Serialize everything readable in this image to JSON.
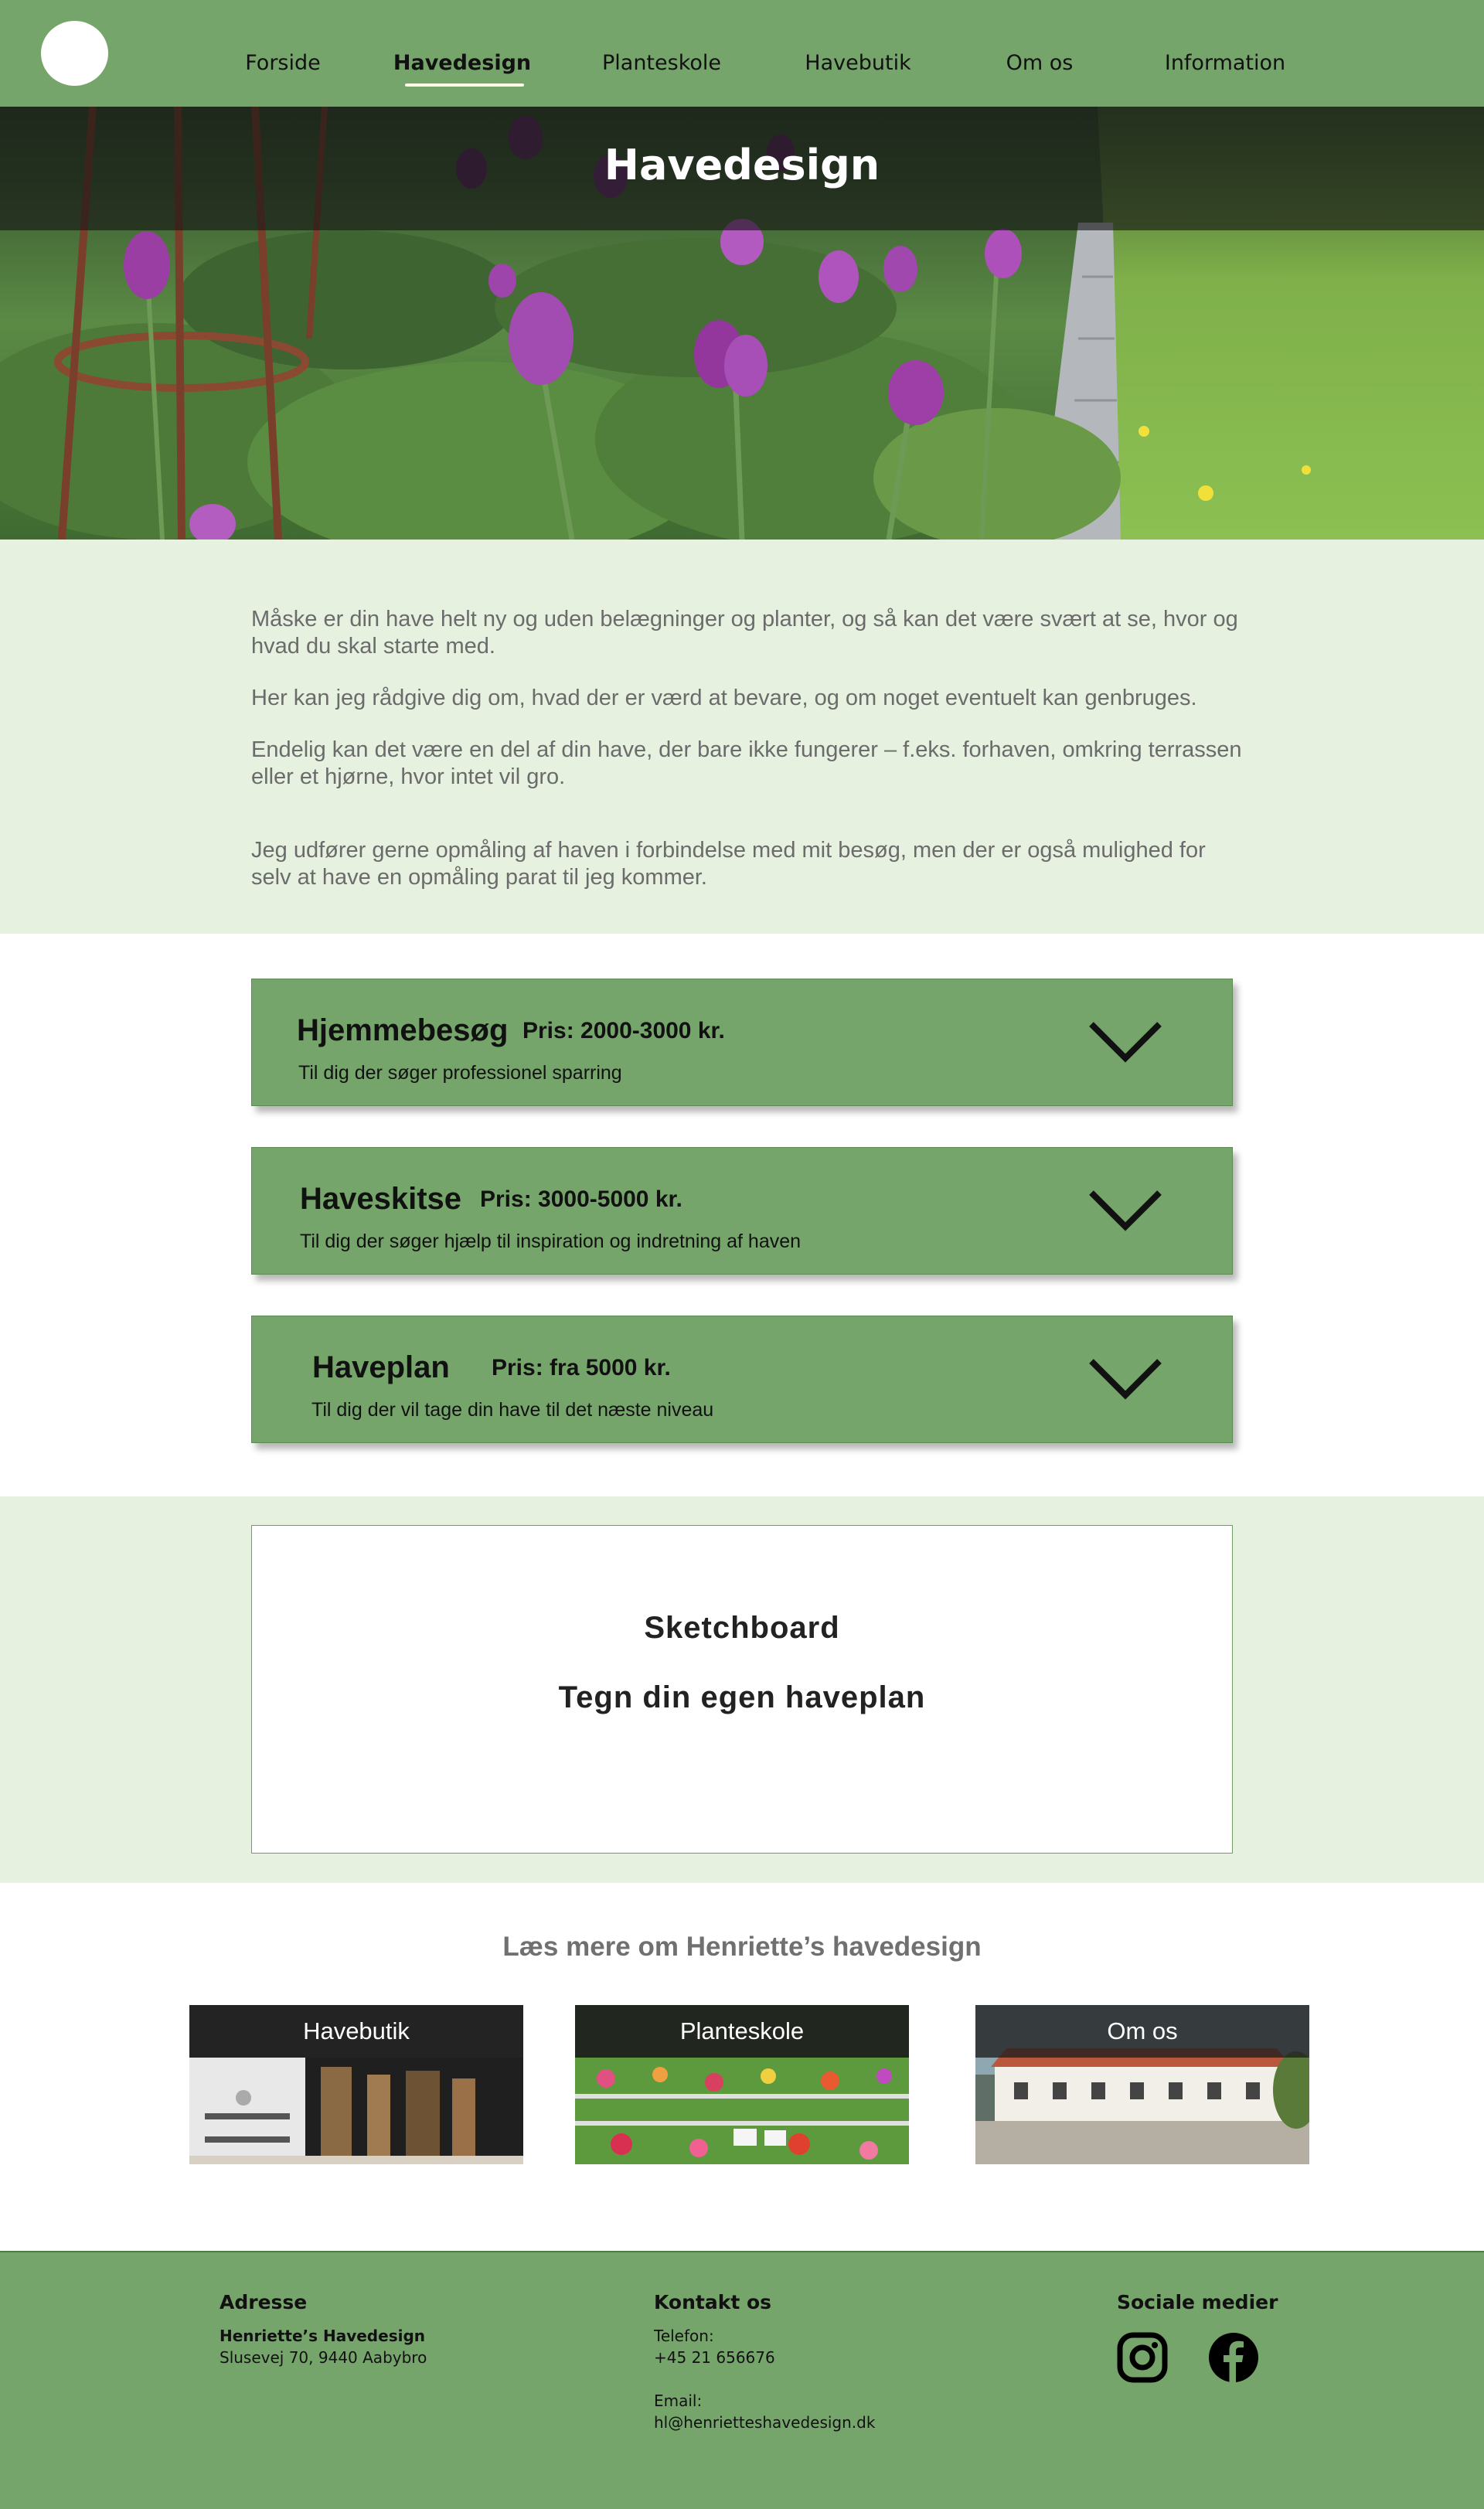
{
  "nav": {
    "items": [
      {
        "label": "Forside"
      },
      {
        "label": "Havedesign"
      },
      {
        "label": "Planteskole"
      },
      {
        "label": "Havebutik"
      },
      {
        "label": "Om os"
      },
      {
        "label": "Information"
      }
    ],
    "active": "Havedesign"
  },
  "hero": {
    "title": "Havedesign"
  },
  "intro": {
    "paragraphs": [
      "Måske er din have helt ny og uden belægninger og planter, og så kan det være svært at se, hvor og hvad du skal starte med.",
      "Her kan jeg rådgive dig om, hvad der er værd at bevare, og om noget eventuelt kan genbruges.",
      "Endelig kan det være en del af din have, der bare ikke fungerer – f.eks. forhaven, omkring terrassen eller et hjørne, hvor intet vil gro.",
      "Jeg udfører gerne opmåling af haven i forbindelse med mit besøg, men der er også mulighed for selv at have en opmåling parat til jeg kommer."
    ]
  },
  "services": [
    {
      "title": "Hjemmebesøg",
      "price": "Pris: 2000-3000 kr.",
      "description": "Til dig der søger professionel sparring"
    },
    {
      "title": "Haveskitse",
      "price": "Pris: 3000-5000 kr.",
      "description": "Til dig der søger hjælp til inspiration og indretning af haven"
    },
    {
      "title": "Haveplan",
      "price": "Pris: fra 5000 kr.",
      "description": "Til dig der vil tage din have til det næste niveau"
    }
  ],
  "sketchboard": {
    "title": "Sketchboard",
    "subtitle": "Tegn din egen haveplan"
  },
  "readmore": {
    "heading": "Læs mere om Henriette’s havedesign",
    "tiles": [
      {
        "label": "Havebutik"
      },
      {
        "label": "Planteskole"
      },
      {
        "label": "Om os"
      }
    ]
  },
  "footer": {
    "address": {
      "heading": "Adresse",
      "name": "Henriette’s Havedesign",
      "street": "Slusevej 70, 9440 Aabybro"
    },
    "contact": {
      "heading": "Kontakt os",
      "phone_label": "Telefon:",
      "phone": "+45 21 656676",
      "email_label": "Email:",
      "email": "hl@henrietteshavedesign.dk"
    },
    "social": {
      "heading": "Sociale medier",
      "icons": [
        "instagram-icon",
        "facebook-icon"
      ]
    }
  },
  "colors": {
    "nav_green": "#76a56b",
    "light_green_bg": "#e6f1e0",
    "card_green": "#76a56b",
    "text_gray": "#6b6b6b"
  }
}
